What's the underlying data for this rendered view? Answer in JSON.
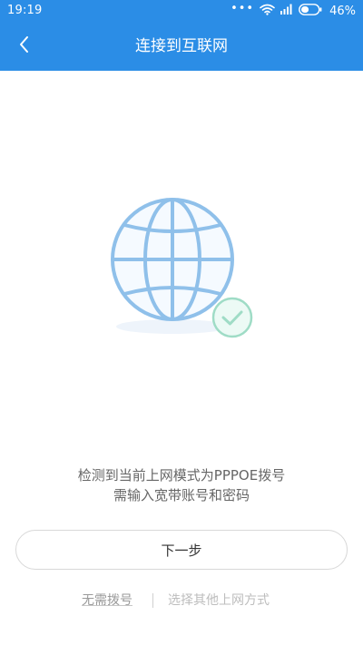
{
  "status_bar": {
    "time": "19:19",
    "dots": "•••",
    "battery_percent": "46%",
    "battery_level": 0.46,
    "icons": [
      "wifi-icon",
      "signal-icon",
      "battery-icon"
    ]
  },
  "nav": {
    "title": "连接到互联网",
    "back_icon": "chevron-left-icon"
  },
  "illustration": {
    "icons": [
      "globe-icon",
      "check-circle-icon"
    ]
  },
  "message": {
    "line1": "检测到当前上网模式为PPPOE拨号",
    "line2": "需输入宽带账号和密码"
  },
  "actions": {
    "next_label": "下一步",
    "no_dial_label": "无需拨号",
    "other_label": "选择其他上网方式"
  },
  "colors": {
    "header": "#2b8de6",
    "globe_stroke": "#8fc0ea",
    "globe_fill": "#f5faff",
    "check_fill": "#ecfaf5",
    "check_stroke": "#9fdcc6"
  }
}
